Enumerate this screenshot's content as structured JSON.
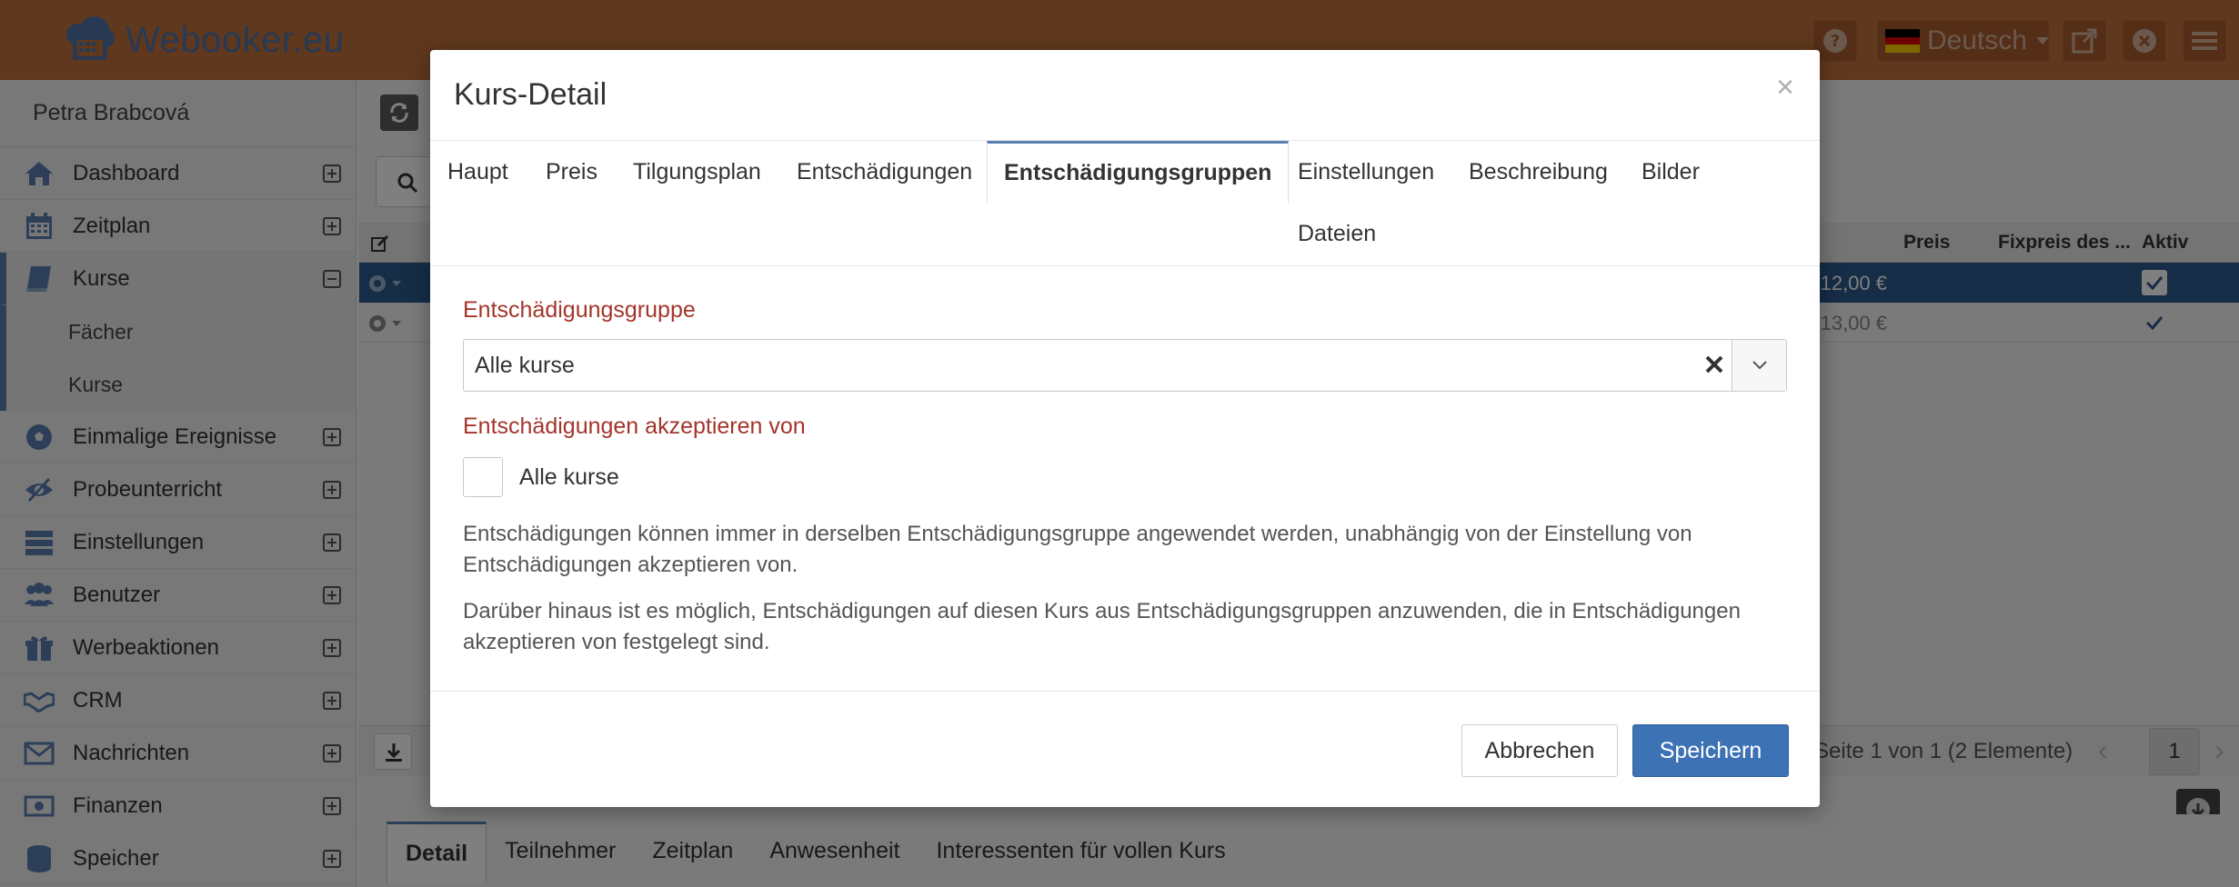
{
  "app": {
    "brand": "Webooker.eu",
    "language": "Deutsch"
  },
  "sidebar": {
    "user": "Petra Brabcová",
    "items": [
      {
        "label": "Dashboard",
        "icon": "home-icon"
      },
      {
        "label": "Zeitplan",
        "icon": "calendar-icon"
      },
      {
        "label": "Kurse",
        "icon": "book-icon",
        "expanded": true
      },
      {
        "label": "Einmalige Ereignisse",
        "icon": "soccer-ball-icon"
      },
      {
        "label": "Probeunterricht",
        "icon": "eye-slash-icon"
      },
      {
        "label": "Einstellungen",
        "icon": "server-icon"
      },
      {
        "label": "Benutzer",
        "icon": "users-icon"
      },
      {
        "label": "Werbeaktionen",
        "icon": "gift-icon"
      },
      {
        "label": "CRM",
        "icon": "handshake-icon"
      },
      {
        "label": "Nachrichten",
        "icon": "envelope-icon"
      },
      {
        "label": "Finanzen",
        "icon": "money-icon"
      },
      {
        "label": "Speicher",
        "icon": "database-icon"
      }
    ],
    "kurse_sub": [
      "Fächer",
      "Kurse"
    ]
  },
  "grid": {
    "headers": {
      "preis": "Preis",
      "fixpreis": "Fixpreis des ...",
      "aktiv": "Aktiv"
    },
    "rows": [
      {
        "preis": "12,00 €",
        "aktiv": true
      },
      {
        "preis": "13,00 €",
        "aktiv": true
      }
    ],
    "pager_text": "Seite 1 von 1 (2 Elemente)",
    "page": "1"
  },
  "detail_tabs": [
    "Detail",
    "Teilnehmer",
    "Zeitplan",
    "Anwesenheit",
    "Interessenten für vollen Kurs"
  ],
  "modal": {
    "title": "Kurs-Detail",
    "close": "×",
    "tabs": [
      "Haupt",
      "Preis",
      "Tilgungsplan",
      "Entschädigungen",
      "Entschädigungsgruppen",
      "Einstellungen",
      "Beschreibung",
      "Bilder",
      "Dateien"
    ],
    "active_tab": "Entschädigungsgruppen",
    "group_label": "Entschädigungsgruppe",
    "group_value": "Alle kurse",
    "accept_label": "Entschädigungen akzeptieren von",
    "accept_option": "Alle kurse",
    "help1": "Entschädigungen können immer in derselben Entschädigungsgruppe angewendet werden, unabhängig von der Einstellung von Entschädigungen akzeptieren von.",
    "help2": "Darüber hinaus ist es möglich, Entschädigungen auf diesen Kurs aus Entschädigungsgruppen anzuwenden, die in Entschädigungen akzeptieren von festgelegt sind.",
    "cancel": "Abbrechen",
    "save": "Speichern"
  },
  "colors": {
    "topbar": "#c0703a",
    "brand": "#5173a8",
    "label_red": "#a3352b",
    "primary": "#3d72b4",
    "selected_row": "#2d5b8f"
  }
}
